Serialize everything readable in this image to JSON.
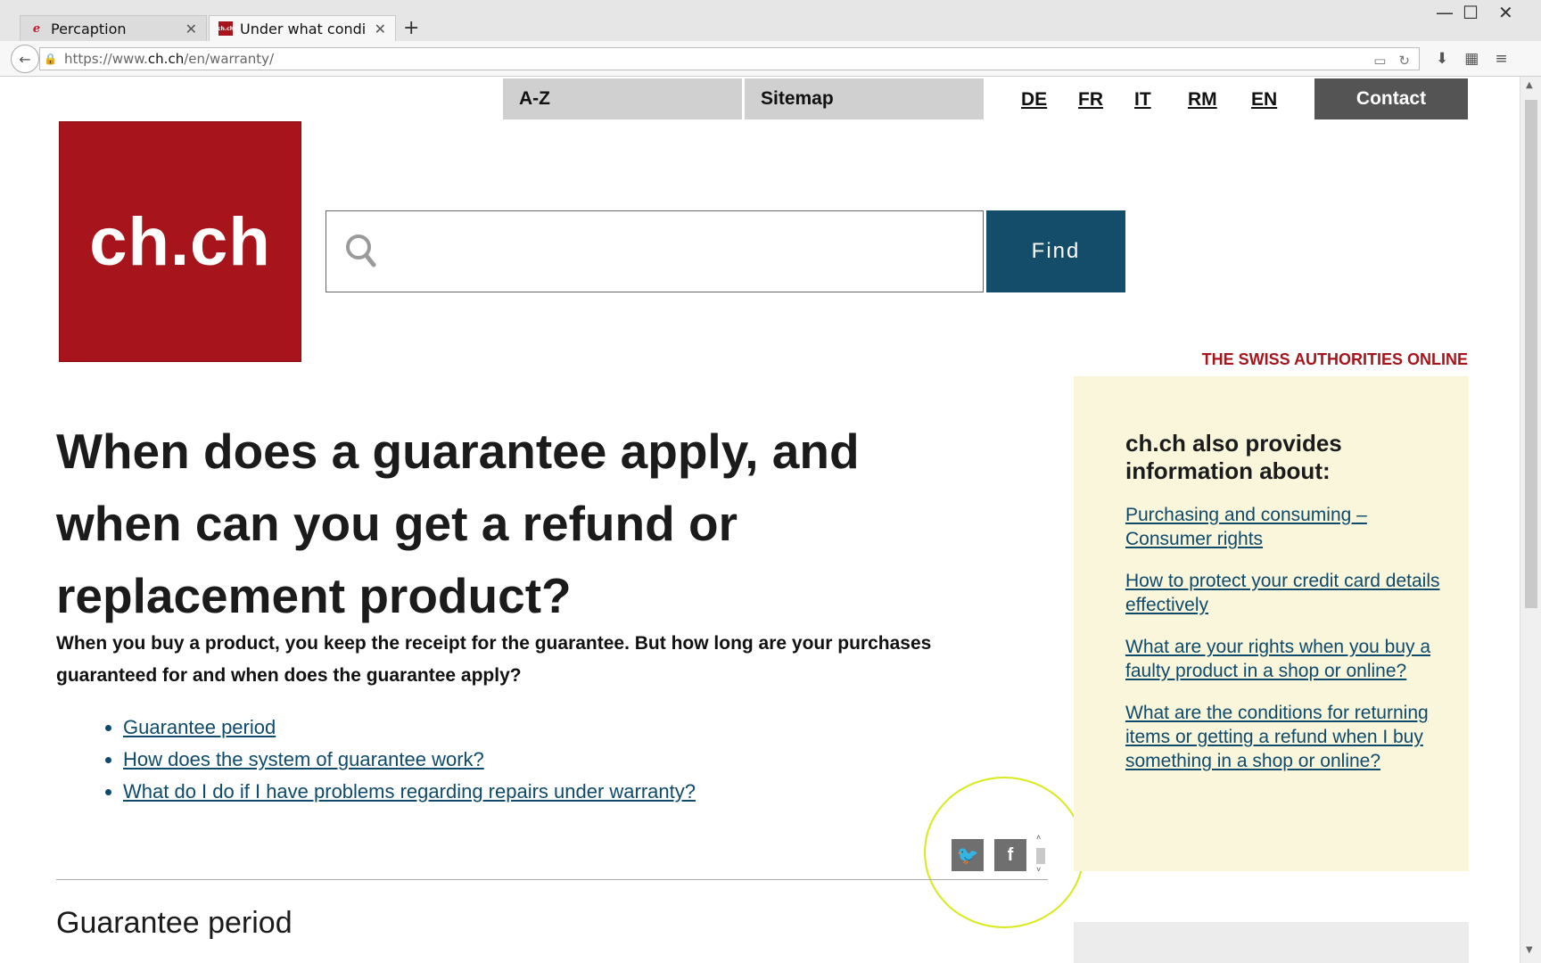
{
  "browser": {
    "tabs": [
      {
        "title": "Percaption",
        "favicon": "percaption-icon"
      },
      {
        "title": "Under what condi...",
        "favicon": "chch-icon"
      }
    ],
    "url_prefix": "https://www.",
    "url_domain": "ch.ch",
    "url_path": "/en/warranty/"
  },
  "topnav": {
    "az": "A-Z",
    "sitemap": "Sitemap",
    "langs": [
      "DE",
      "FR",
      "IT",
      "RM",
      "EN"
    ],
    "contact": "Contact"
  },
  "logo": {
    "text": "ch.ch"
  },
  "search": {
    "placeholder": "",
    "button": "Find"
  },
  "tagline": "THE SWISS AUTHORITIES ONLINE",
  "article": {
    "title": "When does a guarantee apply, and when can you get a refund or replacement product?",
    "intro": "When you buy a product, you keep the receipt for the guarantee. But how long are your purchases guaranteed for and when does the guarantee apply?",
    "toc": [
      "Guarantee period",
      "How does the system of guarantee work?",
      "What do I do if I have problems regarding repairs under warranty?"
    ],
    "section_title": "Guarantee period"
  },
  "sidebar": {
    "heading": "ch.ch also provides information about:",
    "links": [
      "Purchasing and consuming – Consumer rights",
      "How to protect your credit card details effectively",
      "What are your rights when you buy a faulty product in a shop or online?",
      "What are the conditions for returning items or getting a refund when I buy something in a shop or online?"
    ]
  },
  "colors": {
    "brand_red": "#a8141b",
    "find_blue": "#134d6a",
    "link": "#0e4a6b",
    "aside_bg": "#faf6dc"
  }
}
